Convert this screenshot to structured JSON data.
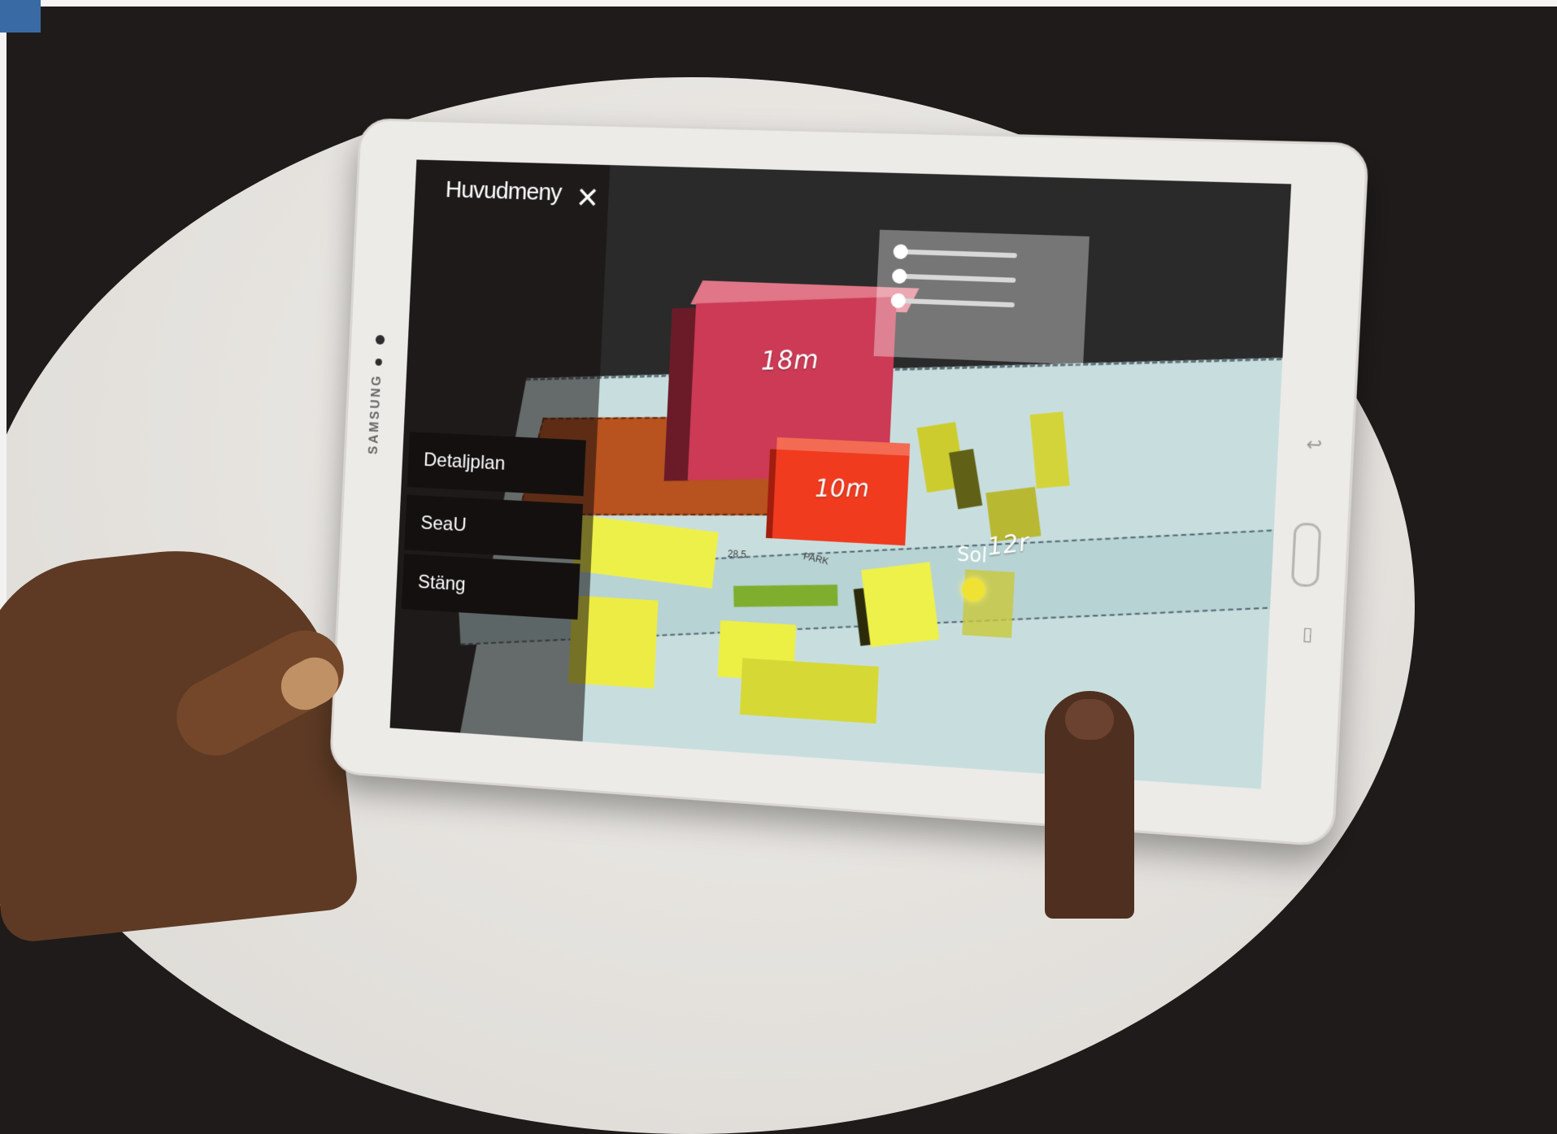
{
  "app": {
    "menu": {
      "title": "Huvudmeny",
      "close_icon": "close-x-icon",
      "items": [
        {
          "label": "Detaljplan"
        },
        {
          "label": "SeaU"
        },
        {
          "label": "Stäng"
        }
      ]
    },
    "sliders": [
      {
        "value": 0
      },
      {
        "value": 0
      },
      {
        "value": 0
      }
    ],
    "buildings": [
      {
        "label": "18m",
        "color": "#cc3a55"
      },
      {
        "label": "10m",
        "color": "#f03b1f"
      },
      {
        "label": "12r",
        "color": "#cccc2f"
      }
    ],
    "sun_button": {
      "label": "Sol",
      "color": "#f0e233"
    },
    "map_text": [
      "28 5",
      "PARK"
    ]
  },
  "device": {
    "brand": "SAMSUNG"
  }
}
